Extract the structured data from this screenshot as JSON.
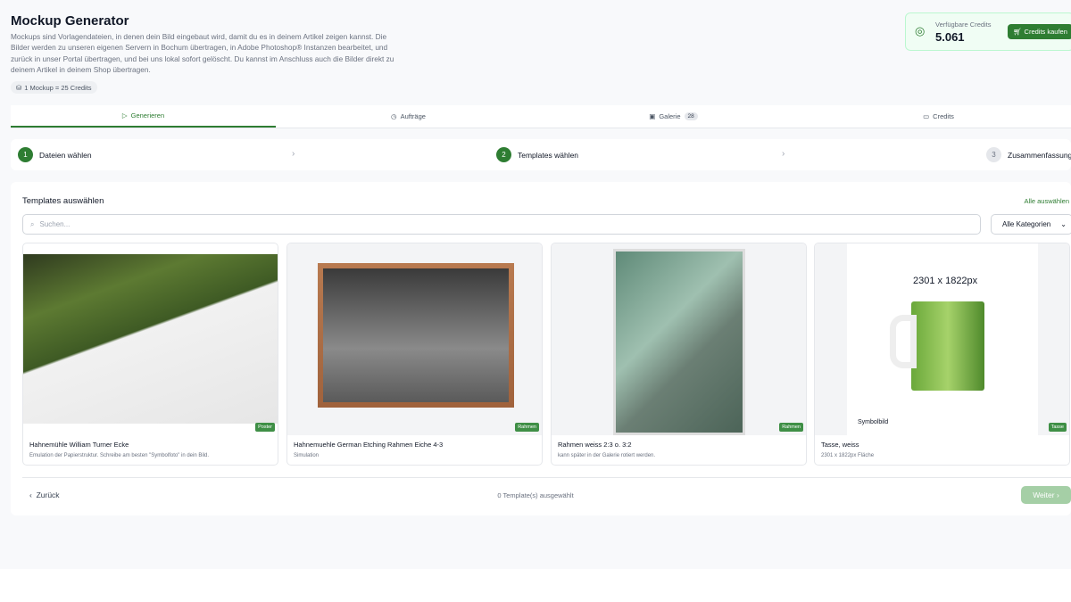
{
  "header": {
    "title": "Mockup Generator",
    "description": "Mockups sind Vorlagendateien, in denen dein Bild eingebaut wird, damit du es in deinem Artikel zeigen kannst. Die Bilder werden zu unseren eigenen Servern in Bochum übertragen, in Adobe Photoshop® Instanzen bearbeitet, und zurück in unser Portal übertragen, und bei uns lokal sofort gelöscht. Du kannst im Anschluss auch die Bilder direkt zu deinem Artikel in deinem Shop übertragen.",
    "price_note": "1 Mockup = 25 Credits"
  },
  "credits": {
    "label": "Verfügbare Credits",
    "value": "5.061",
    "buy_label": "Credits kaufen"
  },
  "tabs": [
    {
      "label": "Generieren"
    },
    {
      "label": "Aufträge"
    },
    {
      "label": "Galerie",
      "badge": "28"
    },
    {
      "label": "Credits"
    }
  ],
  "steps": [
    {
      "num": "1",
      "label": "Dateien wählen"
    },
    {
      "num": "2",
      "label": "Templates wählen"
    },
    {
      "num": "3",
      "label": "Zusammenfassung"
    }
  ],
  "main": {
    "title": "Templates auswählen",
    "select_all": "Alle auswählen",
    "search_placeholder": "Suchen...",
    "category": "Alle Kategorien"
  },
  "templates": [
    {
      "title": "Hahnemühle William Turner Ecke",
      "subtitle": "Emulation der Papierstruktur. Schreibe am besten \"Symbolfoto\" in dein Bild.",
      "tag": "Poster"
    },
    {
      "title": "Hahnemuehle German Etching Rahmen Eiche 4-3",
      "subtitle": "Simulation",
      "tag": "Rahmen"
    },
    {
      "title": "Rahmen weiss 2:3 o. 3:2",
      "subtitle": "kann später in der Galerie rotiert werden.",
      "tag": "Rahmen"
    },
    {
      "title": "Tasse, weiss",
      "subtitle": "2301 x 1822px Fläche",
      "tag": "Tasse",
      "img_size": "2301 x 1822px",
      "img_caption": "Symbolbild"
    }
  ],
  "footer": {
    "back": "Zurück",
    "selected": "0 Template(s) ausgewählt",
    "next": "Weiter"
  }
}
